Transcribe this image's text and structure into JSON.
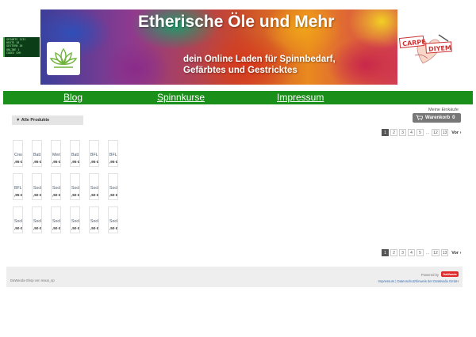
{
  "counter": {
    "rows": [
      {
        "label": "GESAMTS",
        "value": "1131"
      },
      {
        "label": "HEUTE",
        "value": "18"
      },
      {
        "label": "GESTERN",
        "value": "18"
      },
      {
        "label": "ONLINE",
        "value": "1"
      },
      {
        "label": "CODES",
        "value": "CHR"
      }
    ]
  },
  "header": {
    "title": "Etherische Öle und Mehr",
    "subtitle_line1": "dein Online Laden für Spinnbedarf,",
    "subtitle_line2": "Gefärbtes und Gestricktes",
    "carpe_word1": "CARPE",
    "carpe_word2": "DIYEM",
    "logo_icon": "lotus-icon"
  },
  "nav": {
    "items": [
      "Blog",
      "Spinnkurse",
      "Impressum"
    ]
  },
  "cart": {
    "label": "Meine Einkäufe",
    "button": "Warenkorb",
    "count": "0",
    "icon": "cart-icon"
  },
  "category": {
    "label": "▼ Alle Produkte"
  },
  "pager": {
    "pages": [
      "1",
      "2",
      "3",
      "4",
      "5"
    ],
    "ellipsis": "...",
    "tail": [
      "12",
      "13"
    ],
    "next": "Vor ›",
    "active": "1"
  },
  "products": [
    {
      "name": "Crea",
      "price": ",95 €"
    },
    {
      "name": "Batt",
      "price": ",95 €"
    },
    {
      "name": "Meri",
      "price": ",95 €"
    },
    {
      "name": "Batt",
      "price": ",95 €"
    },
    {
      "name": "BFL",
      "price": ",95 €"
    },
    {
      "name": "BFL",
      "price": ",95 €"
    },
    {
      "name": "BFL",
      "price": ",95 €"
    },
    {
      "name": "Sock",
      "price": ",50 €"
    },
    {
      "name": "Sock",
      "price": ",50 €"
    },
    {
      "name": "Sock",
      "price": ",50 €"
    },
    {
      "name": "Sock",
      "price": ",50 €"
    },
    {
      "name": "Sock",
      "price": ",50 €"
    },
    {
      "name": "Sock",
      "price": ",50 €"
    },
    {
      "name": "Sock",
      "price": ",50 €"
    },
    {
      "name": "Sock",
      "price": ",50 €"
    },
    {
      "name": "Sock",
      "price": ",50 €"
    },
    {
      "name": "Sock",
      "price": ",50 €"
    },
    {
      "name": "Sock",
      "price": ",50 €"
    }
  ],
  "footer": {
    "left": "DaWanda-Shop von maus_sp",
    "powered": "Powered by",
    "badge": "DaWanda",
    "link1": "Impressum",
    "separator": " | ",
    "link2": "Datenschutzhinweis der DaWanda GmbH"
  },
  "colors": {
    "nav_green": "#1a8f1a",
    "cart_gray": "#777777",
    "footer_bg": "#eeeeee",
    "badge_red": "#e02828"
  }
}
